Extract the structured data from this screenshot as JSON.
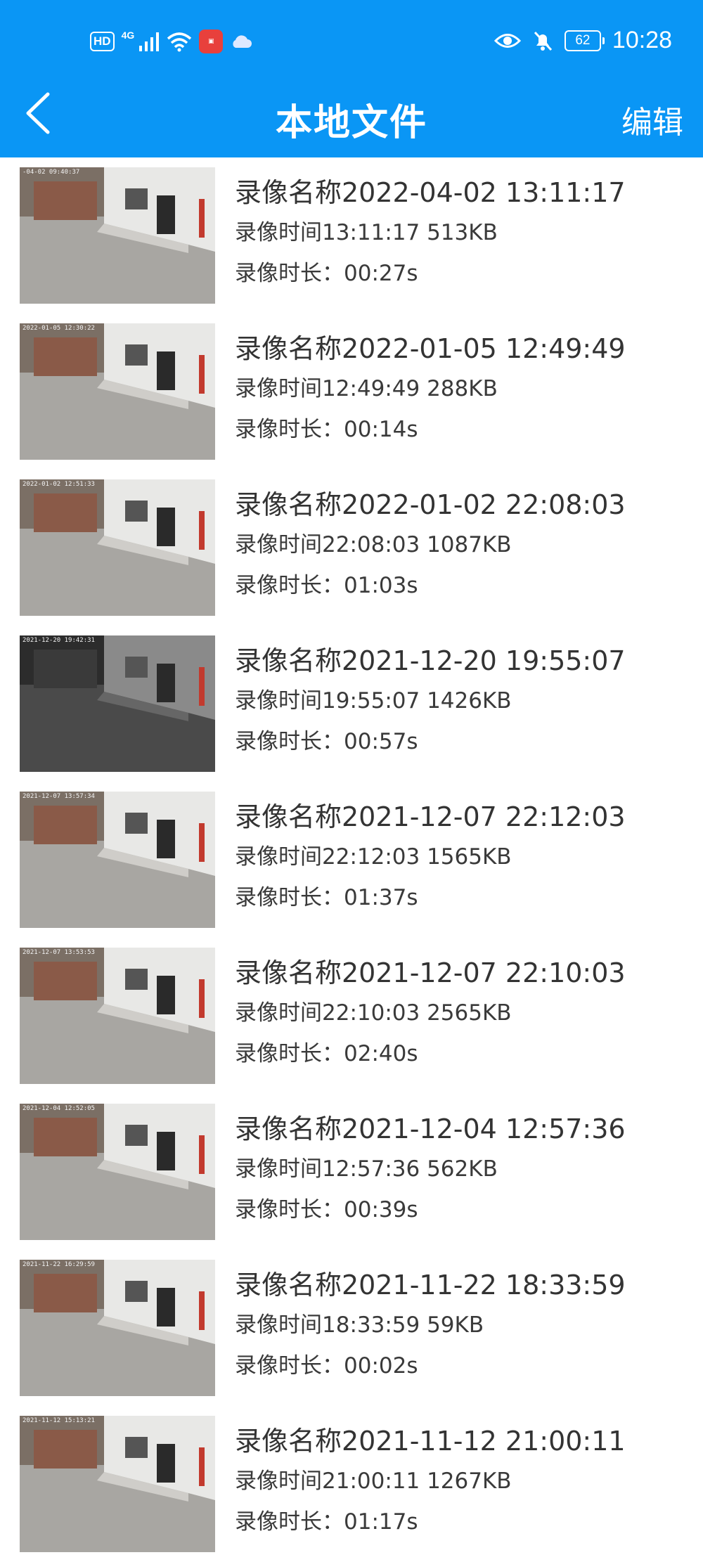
{
  "status_bar": {
    "hd": "HD",
    "network": "4G",
    "battery": "62",
    "time": "10:28"
  },
  "header": {
    "title": "本地文件",
    "edit_label": "编辑"
  },
  "recordings": [
    {
      "name": "录像名称2022-04-02 13:11:17",
      "time": "录像时间13:11:17 513KB",
      "duration": "录像时长：00:27s",
      "osd": "-04-02 09:40:37",
      "night": false
    },
    {
      "name": "录像名称2022-01-05 12:49:49",
      "time": "录像时间12:49:49 288KB",
      "duration": "录像时长：00:14s",
      "osd": "2022-01-05 12:30:22",
      "night": false
    },
    {
      "name": "录像名称2022-01-02 22:08:03",
      "time": "录像时间22:08:03 1087KB",
      "duration": "录像时长：01:03s",
      "osd": "2022-01-02 12:51:33",
      "night": false
    },
    {
      "name": "录像名称2021-12-20 19:55:07",
      "time": "录像时间19:55:07 1426KB",
      "duration": "录像时长：00:57s",
      "osd": "2021-12-20 19:42:31",
      "night": true
    },
    {
      "name": "录像名称2021-12-07 22:12:03",
      "time": "录像时间22:12:03 1565KB",
      "duration": "录像时长：01:37s",
      "osd": "2021-12-07 13:57:34",
      "night": false
    },
    {
      "name": "录像名称2021-12-07 22:10:03",
      "time": "录像时间22:10:03 2565KB",
      "duration": "录像时长：02:40s",
      "osd": "2021-12-07 13:53:53",
      "night": false
    },
    {
      "name": "录像名称2021-12-04 12:57:36",
      "time": "录像时间12:57:36 562KB",
      "duration": "录像时长：00:39s",
      "osd": "2021-12-04 12:52:05",
      "night": false
    },
    {
      "name": "录像名称2021-11-22 18:33:59",
      "time": "录像时间18:33:59 59KB",
      "duration": "录像时长：00:02s",
      "osd": "2021-11-22 16:29:59",
      "night": false
    },
    {
      "name": "录像名称2021-11-12 21:00:11",
      "time": "录像时间21:00:11 1267KB",
      "duration": "录像时长：01:17s",
      "osd": "2021-11-12 15:13:21",
      "night": false
    }
  ],
  "colors": {
    "header_bg": "#0a96f5",
    "text": "#333333"
  }
}
